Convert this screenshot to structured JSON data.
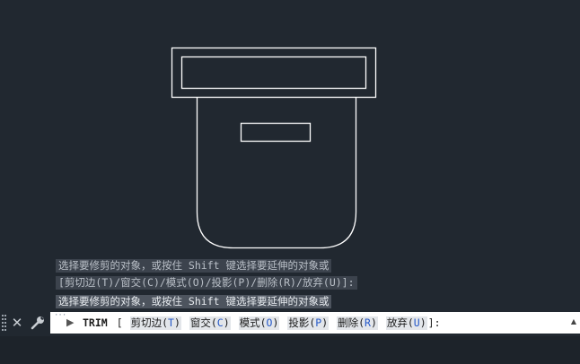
{
  "history": [
    "选择要修剪的对象，或按住 Shift 键选择要延伸的对象或",
    "[剪切边(T)/窗交(C)/模式(O)/投影(P)/删除(R)/放弃(U)]:",
    "选择要修剪的对象，或按住 Shift 键选择要延伸的对象或"
  ],
  "command_line": {
    "command": "TRIM",
    "open_bracket": "[",
    "options": [
      {
        "label": "剪切边(",
        "key": "T",
        "suffix": ")"
      },
      {
        "label": "窗交(",
        "key": "C",
        "suffix": ")"
      },
      {
        "label": "模式(",
        "key": "O",
        "suffix": ")"
      },
      {
        "label": "投影(",
        "key": "P",
        "suffix": ")"
      },
      {
        "label": "删除(",
        "key": "R",
        "suffix": ")"
      },
      {
        "label": "放弃(",
        "key": "U",
        "suffix": ")"
      }
    ],
    "close_bracket": "]:",
    "recent_indicator": "···",
    "chevron": "▶",
    "scroll_up": "▲"
  },
  "icons": {
    "close": "close-icon",
    "customize": "wrench-icon",
    "grip": "drag-grip-icon"
  },
  "colors": {
    "canvas_background": "#212830",
    "drawing_lines": "#ffffff",
    "option_key": "#2458c8",
    "command_input_background": "#ffffff"
  }
}
